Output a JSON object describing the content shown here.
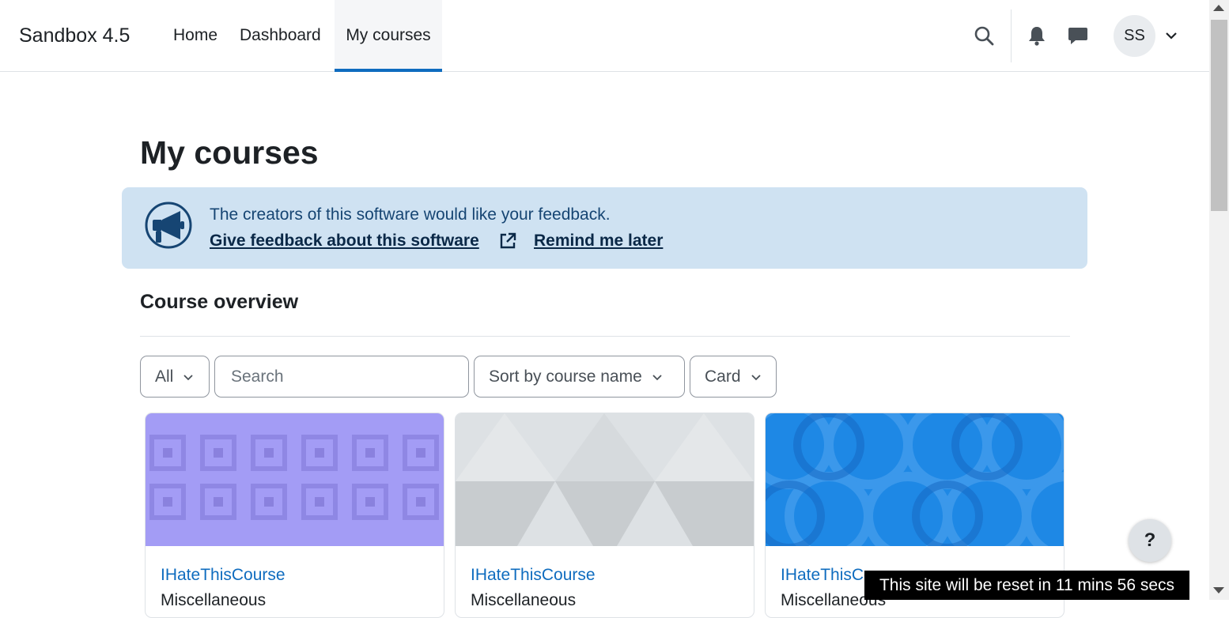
{
  "navbar": {
    "brand": "Sandbox 4.5",
    "links": [
      {
        "label": "Home"
      },
      {
        "label": "Dashboard"
      },
      {
        "label": "My courses",
        "active": true
      }
    ],
    "icons": [
      "search-icon",
      "bell-icon",
      "message-icon",
      "chevron-down-icon"
    ],
    "user_initials": "SS"
  },
  "page": {
    "title": "My courses"
  },
  "feedback": {
    "icon": "megaphone-icon",
    "message": "The creators of this software would like your feedback.",
    "give_link": "Give feedback about this software",
    "external_icon": "external-link-icon",
    "remind_link": "Remind me later"
  },
  "course_overview": {
    "title": "Course overview",
    "filter": {
      "selected": "All"
    },
    "search": {
      "placeholder": "Search",
      "value": ""
    },
    "sort": {
      "selected": "Sort by course name"
    },
    "view": {
      "selected": "Card"
    },
    "courses": [
      {
        "name": "IHateThisCourse",
        "category": "Miscellaneous",
        "image_color": "#a39cf5"
      },
      {
        "name": "IHateThisCourse",
        "category": "Miscellaneous",
        "image_color": "#d5d9dc"
      },
      {
        "name": "IHateThisCourse",
        "category": "Miscellaneous",
        "image_color": "#1e88e5"
      }
    ]
  },
  "help": {
    "label": "?"
  },
  "reset_notice": "This site will be reset in 11 mins 56 secs",
  "colors": {
    "accent": "#0f6cbf",
    "feedback_bg": "#cfe2f2",
    "text": "#1d2125"
  }
}
